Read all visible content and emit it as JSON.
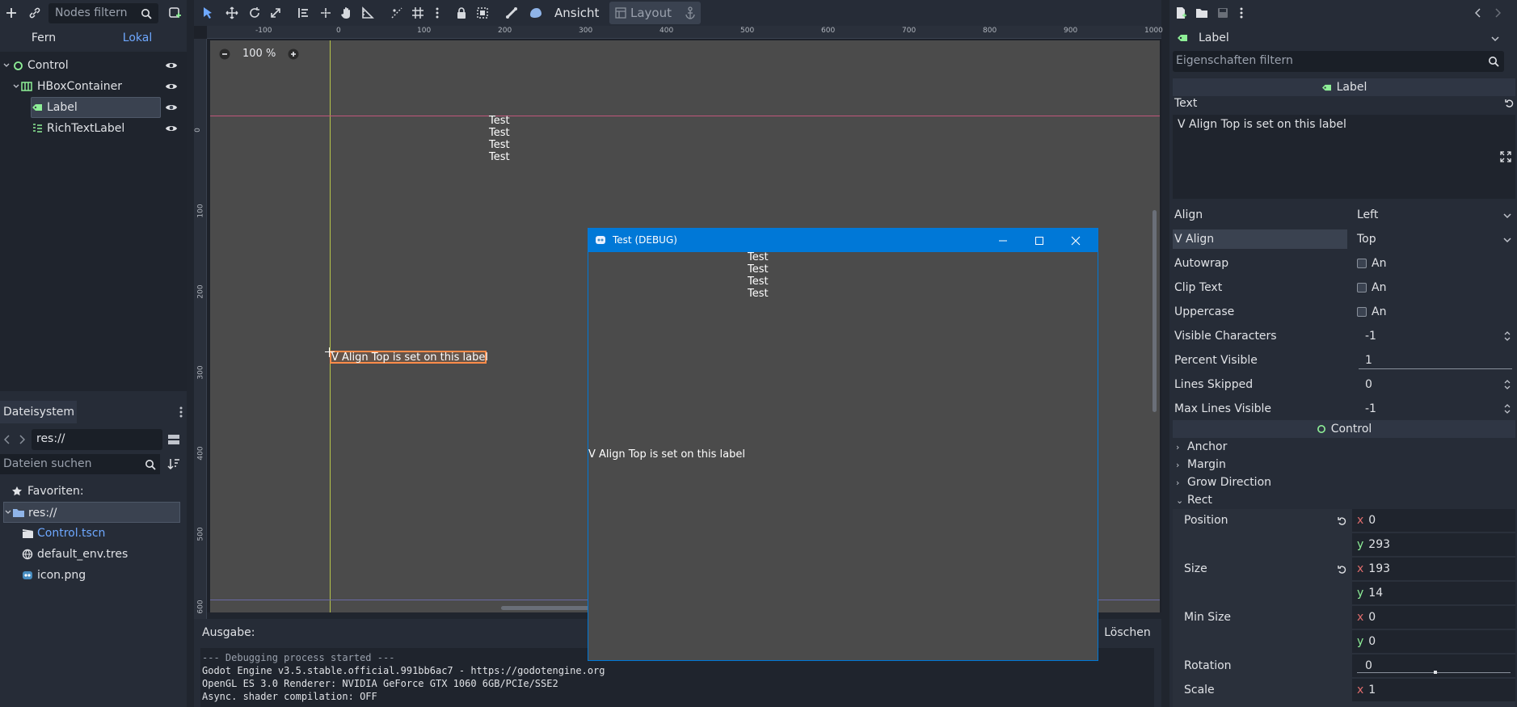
{
  "scene_dock": {
    "filter_placeholder": "Nodes filtern",
    "tabs": [
      {
        "label": "Fern"
      },
      {
        "label": "Lokal"
      }
    ],
    "tree": [
      {
        "label": "Control"
      },
      {
        "label": "HBoxContainer"
      },
      {
        "label": "Label"
      },
      {
        "label": "RichTextLabel"
      }
    ]
  },
  "filesystem_dock": {
    "tab_label": "Dateisystem",
    "path": "res://",
    "search_placeholder": "Dateien suchen",
    "favorites_label": "Favoriten:",
    "items": [
      {
        "label": "res://"
      },
      {
        "label": "Control.tscn"
      },
      {
        "label": "default_env.tres"
      },
      {
        "label": "icon.png"
      }
    ]
  },
  "toolbar": {
    "view_label": "Ansicht",
    "layout_label": "Layout"
  },
  "viewport": {
    "zoom": "100 %",
    "ruler_h_ticks": [
      "-100",
      "0",
      "100",
      "200",
      "300",
      "400",
      "500",
      "600",
      "700",
      "800",
      "900",
      "1000"
    ],
    "ruler_v_ticks": [
      "0",
      "100",
      "200",
      "300",
      "400",
      "500",
      "600"
    ],
    "test_lines": [
      "Test",
      "Test",
      "Test",
      "Test"
    ],
    "label_text": "V Align Top is set on this label"
  },
  "debug_window": {
    "title": "Test (DEBUG)",
    "test_lines": [
      "Test",
      "Test",
      "Test",
      "Test"
    ],
    "label_text": "V Align Top is set on this label"
  },
  "output": {
    "title": "Ausgabe:",
    "clear_label": "Löschen",
    "lines": [
      "--- Debugging process started ---",
      "Godot Engine v3.5.stable.official.991bb6ac7 - https://godotengine.org",
      "OpenGL ES 3.0 Renderer: NVIDIA GeForce GTX 1060 6GB/PCIe/SSE2",
      "Async. shader compilation: OFF"
    ]
  },
  "inspector": {
    "node_name": "Label",
    "filter_placeholder": "Eigenschaften filtern",
    "label_section": "Label",
    "text_prop": "Text",
    "text_value": "V Align Top is set on this label",
    "props": [
      {
        "name": "Align",
        "value": "Left"
      },
      {
        "name": "V Align",
        "value": "Top"
      },
      {
        "name": "Autowrap",
        "value": "An"
      },
      {
        "name": "Clip Text",
        "value": "An"
      },
      {
        "name": "Uppercase",
        "value": "An"
      },
      {
        "name": "Visible Characters",
        "value": "-1"
      },
      {
        "name": "Percent Visible",
        "value": "1"
      },
      {
        "name": "Lines Skipped",
        "value": "0"
      },
      {
        "name": "Max Lines Visible",
        "value": "-1"
      }
    ],
    "control_section": "Control",
    "subsections": [
      "Anchor",
      "Margin",
      "Grow Direction",
      "Rect"
    ],
    "rect": {
      "position_label": "Position",
      "position_x": "0",
      "position_y": "293",
      "size_label": "Size",
      "size_x": "193",
      "size_y": "14",
      "min_size_label": "Min Size",
      "min_size_x": "0",
      "min_size_y": "0",
      "rotation_label": "Rotation",
      "rotation_value": "0",
      "scale_label": "Scale",
      "scale_x": "1"
    },
    "axis_x": "x",
    "axis_y": "y"
  },
  "colors": {
    "accent": "#6ea8ff",
    "selection_orange": "#ff8c4a",
    "window_blue": "#0078d7",
    "node_green": "#8eef97"
  }
}
